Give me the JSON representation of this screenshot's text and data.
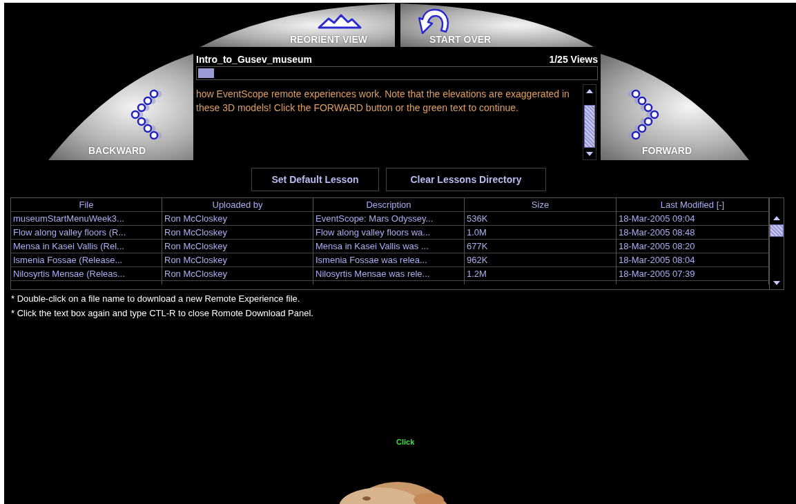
{
  "nav_buttons": {
    "reorient": "REORIENT VIEW",
    "start_over": "START OVER",
    "backward": "BACKWARD",
    "forward": "FORWARD"
  },
  "lesson": {
    "title": "Intro_to_Gusev_museum",
    "views": "1/25 Views",
    "level": 0.04,
    "text": "how EventScope remote experiences work. Note that the elevations are exaggerated in these 3D models! Click the FORWARD button or the green text to continue."
  },
  "buttons": [
    "Set Default Lesson",
    "Clear Lessons Directory"
  ],
  "table": {
    "columns": [
      "File",
      "Uploaded by",
      "Description",
      "Size",
      "Last Modified [-]"
    ],
    "rows": [
      [
        "museumStartMenuWeek3...",
        "Ron McCloskey",
        "EventScope: Mars Odyssey...",
        "536K",
        "18-Mar-2005 09:04"
      ],
      [
        "Flow along valley floors (R...",
        "Ron McCloskey",
        "Flow along valley floors wa...",
        "1.0M",
        "18-Mar-2005 08:48"
      ],
      [
        "Mensa in Kasei Vallis (Rel...",
        "Ron McCloskey",
        "Mensa in Kasei Vallis was ...",
        "677K",
        "18-Mar-2005 08:20"
      ],
      [
        "Ismenia Fossae (Release...",
        "Ron McCloskey",
        "Ismenia Fossae was relea...",
        "962K",
        "18-Mar-2005 08:04"
      ],
      [
        "Nilosyrtis Mensae (Releas...",
        "Ron McCloskey",
        "Nilosyrtis Mensae was rele...",
        "1.2M",
        "18-Mar-2005 07:39"
      ]
    ]
  },
  "notes": [
    "* Double-click on a file name to download a new Remote Experience file.",
    "* Click the text box again and type CTL-R to close Romote Download Panel."
  ],
  "scene": {
    "link": "Click",
    "kind": "picture"
  }
}
